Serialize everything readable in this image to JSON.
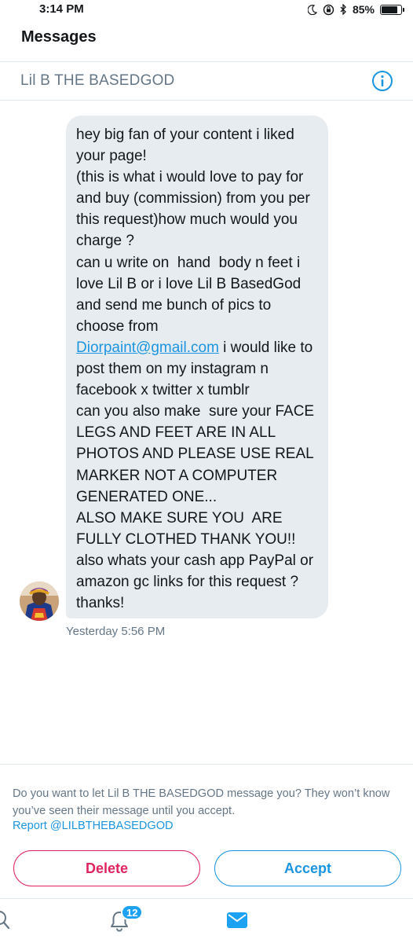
{
  "status_bar": {
    "time": "3:14 PM",
    "battery": "85%",
    "battery_level": 0.85,
    "icons": [
      "moon-icon",
      "orientation-lock-icon",
      "bluetooth-icon",
      "battery-icon"
    ]
  },
  "header": {
    "title": "Messages"
  },
  "thread": {
    "name": "Lil B THE BASEDGOD",
    "info_icon": "info-icon"
  },
  "message": {
    "text_before_link": "hey big fan of your content i liked your page!\n(this is what i would love to pay for and buy (commission) from you per this request)how much would you charge ?\ncan u write on  hand  body n feet i love Lil B or i love Lil B BasedGod and send me bunch of pics to choose from\n",
    "link": "Diorpaint@gmail.com",
    "text_after_link": " i would like to post them on my instagram n facebook x twitter x tumblr\ncan you also make  sure your FACE LEGS AND FEET ARE IN ALL PHOTOS AND PLEASE USE REAL MARKER NOT A COMPUTER GENERATED ONE...\nALSO MAKE SURE YOU  ARE FULLY CLOTHED THANK YOU!!\nalso whats your cash app PayPal or amazon gc links for this request ? thanks!",
    "timestamp": "Yesterday 5:56 PM"
  },
  "request": {
    "prompt": "Do you want to let Lil B THE BASEDGOD message you? They won’t know you’ve seen their message until you accept.",
    "report_link": "Report @LILBTHEBASEDGOD",
    "delete_label": "Delete",
    "accept_label": "Accept"
  },
  "tab_bar": {
    "notification_count": "12",
    "icons": [
      "search-icon",
      "bell-icon",
      "mail-icon"
    ]
  },
  "colors": {
    "accent": "#1b95e0",
    "danger": "#e0245e",
    "bubble": "#e6ecf0",
    "muted": "#657786"
  }
}
